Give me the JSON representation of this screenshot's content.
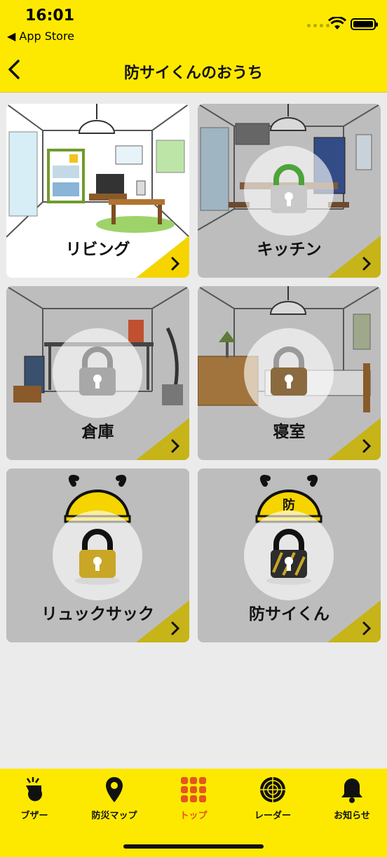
{
  "status_bar": {
    "time": "16:01",
    "back_app": "◀ App Store"
  },
  "nav": {
    "title": "防サイくんのおうち"
  },
  "rooms": [
    {
      "label": "リビング",
      "locked": false
    },
    {
      "label": "キッチン",
      "locked": true
    },
    {
      "label": "倉庫",
      "locked": true
    },
    {
      "label": "寝室",
      "locked": true
    },
    {
      "label": "リュックサック",
      "locked": true
    },
    {
      "label": "防サイくん",
      "locked": true
    }
  ],
  "character_helmet_text": "防",
  "tabs": [
    {
      "label": "ブザー",
      "icon": "whistle-icon"
    },
    {
      "label": "防災マップ",
      "icon": "map-pin-icon"
    },
    {
      "label": "トップ",
      "icon": "grid-icon",
      "active": true
    },
    {
      "label": "レーダー",
      "icon": "radar-icon"
    },
    {
      "label": "お知らせ",
      "icon": "bell-icon"
    }
  ],
  "colors": {
    "header_yellow": "#fde900",
    "active_tab": "#e3561c",
    "corner": "#c6b418"
  }
}
